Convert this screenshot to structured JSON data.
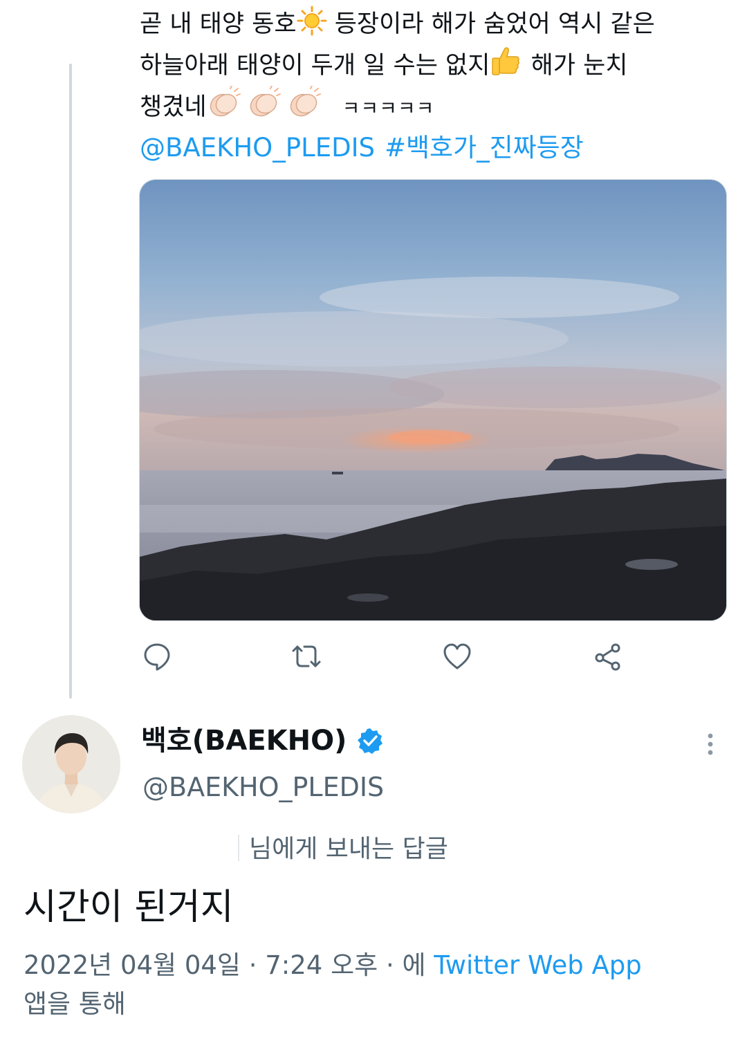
{
  "first_tweet": {
    "lines": [
      {
        "before": "곧 내 태양 동호",
        "emoji": "sun",
        "after": " 등장이라 해가 숨었어 역시 같은"
      },
      {
        "before": "하늘아래 태양이 두개 일 수는 없지",
        "emoji": "thumbs-up",
        "after": " 해가 눈치"
      },
      {
        "before": "챙겼네",
        "emoji": "clapping-hands",
        "after": "ㅋㅋㅋㅋㅋ"
      }
    ],
    "mention": "@BAEKHO_PLEDIS",
    "hashtag": "#백호가_진짜등장",
    "photo": {
      "icon": "sunset-seaside-photo"
    }
  },
  "actions": [
    {
      "name": "reply-button",
      "icon": "reply-icon"
    },
    {
      "name": "retweet-button",
      "icon": "retweet-icon"
    },
    {
      "name": "like-button",
      "icon": "heart-icon"
    },
    {
      "name": "share-button",
      "icon": "share-icon"
    }
  ],
  "reply_tweet": {
    "author_name": "백호(BAEKHO)",
    "author_handle": "@BAEKHO_PLEDIS",
    "reply_to_text": "님에게 보내는 답글",
    "text": "시간이 된거지",
    "date_prefix": "2022년 04월 04일 · 7:24 오후 · 에 ",
    "source_app": "Twitter Web App",
    "date_suffix": "앱을 통해"
  },
  "colors": {
    "link": "#1d9bf0",
    "secondary_text": "#536471",
    "thread_line": "#cfd9de",
    "verified": "#1d9bf0"
  }
}
